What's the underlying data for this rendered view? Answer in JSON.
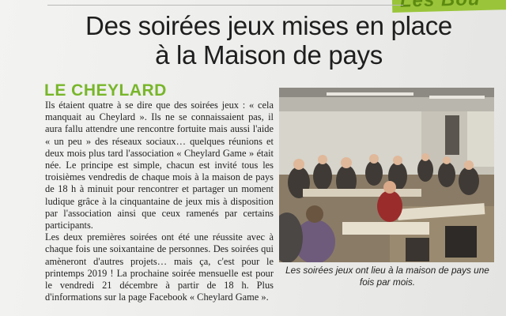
{
  "banner": {
    "section_tag": "Les Bou"
  },
  "article": {
    "headline_line1": "Des soirées jeux mises en place",
    "headline_line2": "à la Maison de pays",
    "kicker": "LE CHEYLARD",
    "paragraphs": [
      "Ils étaient quatre à se dire que des soirées jeux : « cela manquait au Cheylard ». Ils ne se connaissaient pas, il aura fallu attendre une rencontre fortuite mais aussi l'aide « un peu » des réseaux sociaux… quelques réunions et deux mois plus tard l'association « Cheylard Game » était née. Le principe est simple, chacun est invité tous les troisièmes vendredis de chaque mois à la maison de pays de 18 h à minuit pour rencontrer et partager un moment ludique grâce à la cinquantaine de jeux mis à disposition par l'association ainsi que ceux ramenés par certains participants.",
      "Les deux premières soirées ont été une réussite avec à chaque fois une soixantaine de personnes. Des soirées qui amèneront d'autres projets… mais ça, c'est pour le printemps 2019 ! La prochaine soirée mensuelle est pour le vendredi 21 décembre à partir de 18 h. Plus d'informations sur la page Facebook « Cheylard Game »."
    ],
    "photo_caption": "Les soirées jeux ont lieu à la maison de pays une fois par mois."
  },
  "colors": {
    "kicker_green": "#78b62a",
    "tab_green": "#9ac53a"
  }
}
